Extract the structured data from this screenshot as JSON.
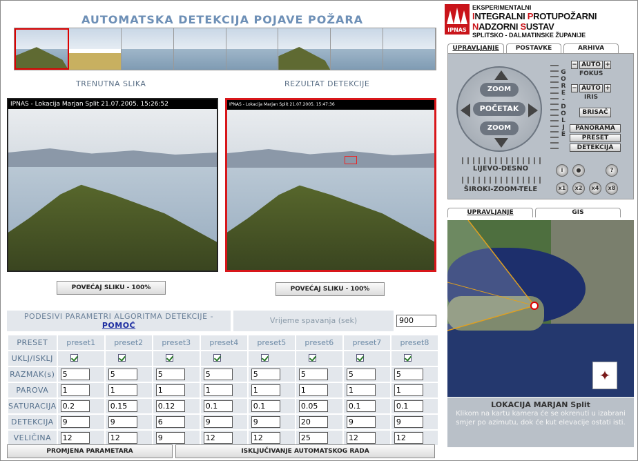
{
  "header": {
    "title": "AUTOMATSKA DETEKCIJA POJAVE POŽARA"
  },
  "labels": {
    "current_image": "TRENUTNA SLIKA",
    "detection_result": "REZULTAT DETEKCIJE"
  },
  "images": {
    "left_caption": "IPNAS - Lokacija Marjan Split 21.07.2005. 15:26:52",
    "right_caption": "IPNAS - Lokacija Marjan Split 21.07.2005. 15:47:36",
    "enlarge_left": "POVEĆAJ SLIKU - 100%",
    "enlarge_right": "POVEĆAJ SLIKU - 100%"
  },
  "params": {
    "heading": "PODESIVI PARAMETRI ALGORITMA DETEKCIJE -",
    "help_link": "POMOĆ",
    "sleep_label": "Vrijeme spavanja (sek)",
    "sleep_value": "900",
    "corner": "PRESET",
    "presets": [
      "preset1",
      "preset2",
      "preset3",
      "preset4",
      "preset5",
      "preset6",
      "preset7",
      "preset8"
    ],
    "row_labels": {
      "enable": "UKLJ/ISKLJ",
      "spacing": "RAZMAK(s)",
      "pairs": "PAROVA",
      "saturation": "SATURACIJA",
      "detection": "DETEKCIJA",
      "size": "VELIČINA"
    },
    "spacing": [
      "5",
      "5",
      "5",
      "5",
      "5",
      "5",
      "5",
      "5"
    ],
    "pairs": [
      "1",
      "1",
      "1",
      "1",
      "1",
      "1",
      "1",
      "1"
    ],
    "saturation": [
      "0.2",
      "0.15",
      "0.12",
      "0.1",
      "0.1",
      "0.05",
      "0.1",
      "0.1"
    ],
    "detection": [
      "9",
      "9",
      "6",
      "9",
      "9",
      "20",
      "9",
      "9"
    ],
    "size": [
      "12",
      "12",
      "9",
      "12",
      "12",
      "25",
      "12",
      "12"
    ],
    "change_button": "PROMJENA PARAMETARA",
    "auto_off_button": "ISKLJUČIVANJE AUTOMATSKOG RADA"
  },
  "logo": {
    "badge": "IPNAS",
    "line1": "EKSPERIMENTALNI",
    "line2_a": "I",
    "line2_b": "NTEGRALNI ",
    "line2_c": "P",
    "line2_d": "ROTUPOŽARNI ",
    "line2_e": "N",
    "line2_f": "ADZORNI ",
    "line2_g": "S",
    "line2_h": "USTAV",
    "line3": "SPLITSKO - DALMATINSKE ŽUPANIJE"
  },
  "top_tabs": [
    "UPRAVLJANJE",
    "POSTAVKE",
    "ARHIVA"
  ],
  "control": {
    "zoom_in": "ZOOM",
    "home": "POČETAK",
    "zoom_out": "ZOOM",
    "up_down": "G O R E - D O L J E",
    "auto_focus": "AUTO",
    "focus": "FOKUS",
    "auto_iris": "AUTO",
    "iris": "IRIS",
    "wiper": "BRISAČ",
    "panorama": "PANORAMA",
    "preset": "PRESET",
    "detection": "DETEKCIJA",
    "left_right": "LIJEVO-DESNO",
    "wide_tele": "ŠIROKI-ZOOM-TELE",
    "speed_buttons": [
      "x1",
      "x2",
      "x4",
      "x8"
    ]
  },
  "bottom_tabs": [
    "UPRAVLJANJE",
    "GIS"
  ],
  "location": {
    "title": "LOKACIJA MARJAN Split",
    "description": "Klikom na kartu kamera će se okrenuti u izabrani smjer po azimutu, dok će kut elevacije ostati isti."
  }
}
